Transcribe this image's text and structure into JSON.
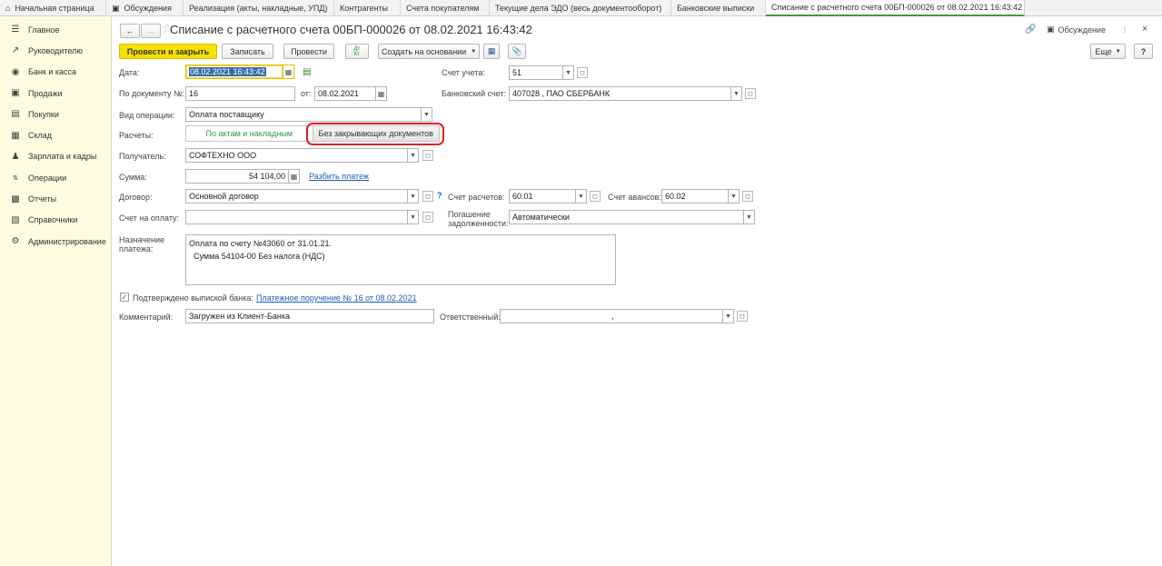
{
  "tabs": [
    {
      "label": "Начальная страница",
      "icon": "home-icon"
    },
    {
      "label": "Обсуждения",
      "icon": "chat-icon"
    },
    {
      "label": "Реализация (акты, накладные, УПД)"
    },
    {
      "label": "Контрагенты"
    },
    {
      "label": "Счета покупателям"
    },
    {
      "label": "Текущие дела ЭДО (весь документооборот)"
    },
    {
      "label": "Банковские выписки"
    },
    {
      "label": "Списание с расчетного счета 00БП-000026 от 08.02.2021 16:43:42",
      "active": true
    }
  ],
  "sidebar": {
    "items": [
      {
        "label": "Главное",
        "icon": "menu-icon"
      },
      {
        "label": "Руководителю",
        "icon": "trend-icon"
      },
      {
        "label": "Банк и касса",
        "icon": "coin-icon"
      },
      {
        "label": "Продажи",
        "icon": "bag-icon"
      },
      {
        "label": "Покупки",
        "icon": "cart-icon"
      },
      {
        "label": "Склад",
        "icon": "warehouse-icon"
      },
      {
        "label": "Зарплата и кадры",
        "icon": "people-icon"
      },
      {
        "label": "Операции",
        "icon": "dt-kt-icon"
      },
      {
        "label": "Отчеты",
        "icon": "bar-chart-icon"
      },
      {
        "label": "Справочники",
        "icon": "book-icon"
      },
      {
        "label": "Администрирование",
        "icon": "gear-icon"
      }
    ]
  },
  "header": {
    "title": "Списание с расчетного счета 00БП-000026 от 08.02.2021 16:43:42",
    "discussion": "Обсуждение"
  },
  "toolbar": {
    "post_close": "Провести и закрыть",
    "save": "Записать",
    "post": "Провести",
    "create_based": "Создать на основании",
    "more": "Еще",
    "help": "?"
  },
  "form": {
    "date_label": "Дата:",
    "date_value": "08.02.2021 16:43:42",
    "doc_no_label": "По документу №:",
    "doc_no_value": "16",
    "from_label": "от:",
    "from_value": "08.02.2021",
    "account_label": "Счет учета:",
    "account_value": "51",
    "bank_account_label": "Банковский счет:",
    "bank_account_value": "407028                              , ПАО СБЕРБАНК",
    "op_type_label": "Вид операции:",
    "op_type_value": "Оплата поставщику",
    "settlements_label": "Расчеты:",
    "settle_opt1": "По актам и накладным",
    "settle_opt2": "Без закрывающих документов",
    "recipient_label": "Получатель:",
    "recipient_value": "СОФТЕХНО ООО",
    "amount_label": "Сумма:",
    "amount_value": "54 104,00",
    "split_link": "Разбить платеж",
    "contract_label": "Договор:",
    "contract_value": "Основной договор",
    "settle_acc_label": "Счет расчетов:",
    "settle_acc_value": "60.01",
    "advance_acc_label": "Счет авансов:",
    "advance_acc_value": "60.02",
    "invoice_label": "Счет на оплату:",
    "invoice_value": "",
    "debt_label_1": "Погашение",
    "debt_label_2": "задолженности:",
    "debt_value": "Автоматически",
    "purpose_label_1": "Назначение",
    "purpose_label_2": "платежа:",
    "purpose_line1": "Оплата по счету №43060 от 31.01.21.",
    "purpose_line2": "Сумма 54104-00 Без налога (НДС)",
    "confirmed_label": "Подтверждено выпиской банка:",
    "confirmed_link": "Платежное поручение № 16 от 08.02.2021",
    "comment_label": "Комментарий:",
    "comment_value": "Загружен из Клиент-Банка",
    "responsible_label": "Ответственный:",
    "responsible_value": ","
  }
}
